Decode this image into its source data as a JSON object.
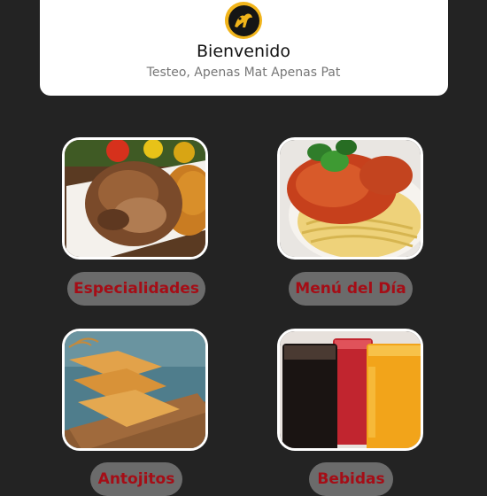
{
  "header": {
    "welcome": "Bienvenido",
    "user_line": "Testeo, Apenas Mat Apenas Pat"
  },
  "menu": [
    {
      "label": "Especialidades"
    },
    {
      "label": "Menú del Día"
    },
    {
      "label": "Antojitos"
    },
    {
      "label": "Bebidas"
    }
  ],
  "colors": {
    "background": "#232323",
    "button_bg": "#6b6b6b",
    "button_text": "#a50d16",
    "logo_gold": "#f1b41a"
  }
}
